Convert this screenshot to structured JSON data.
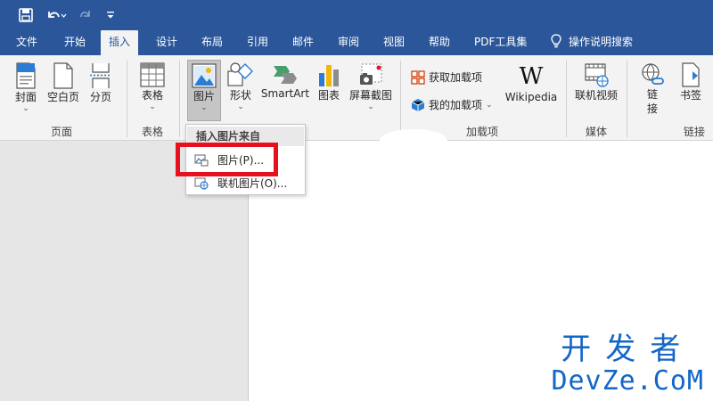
{
  "tabs": [
    "文件",
    "开始",
    "插入",
    "设计",
    "布局",
    "引用",
    "邮件",
    "审阅",
    "视图",
    "帮助",
    "PDF工具集"
  ],
  "tell_me": "操作说明搜索",
  "ribbon": {
    "pages": {
      "cover": "封面",
      "blank": "空白页",
      "break": "分页",
      "label": "页面"
    },
    "tables": {
      "table": "表格",
      "label": "表格"
    },
    "illustrations": {
      "picture": "图片",
      "shapes": "形状",
      "smartart": "SmartArt",
      "chart": "图表",
      "screenshot": "屏幕截图"
    },
    "addins": {
      "get": "获取加载项",
      "mine": "我的加载项",
      "wikipedia": "Wikipedia",
      "wiki_logo": "W",
      "label": "加载项"
    },
    "media": {
      "online_video": "联机视频",
      "label": "媒体"
    },
    "links": {
      "link": "链接",
      "bookmark": "书签",
      "label": "链接"
    }
  },
  "dropdown": {
    "header": "插入图片来自",
    "items": [
      "图片(P)...",
      "联机图片(O)..."
    ]
  },
  "watermark": {
    "cn": "开发者",
    "en": "DevZe.CoM"
  },
  "colors": {
    "accent": "#2b579a",
    "highlight": "#e8101e",
    "watermark": "#1366c6"
  }
}
